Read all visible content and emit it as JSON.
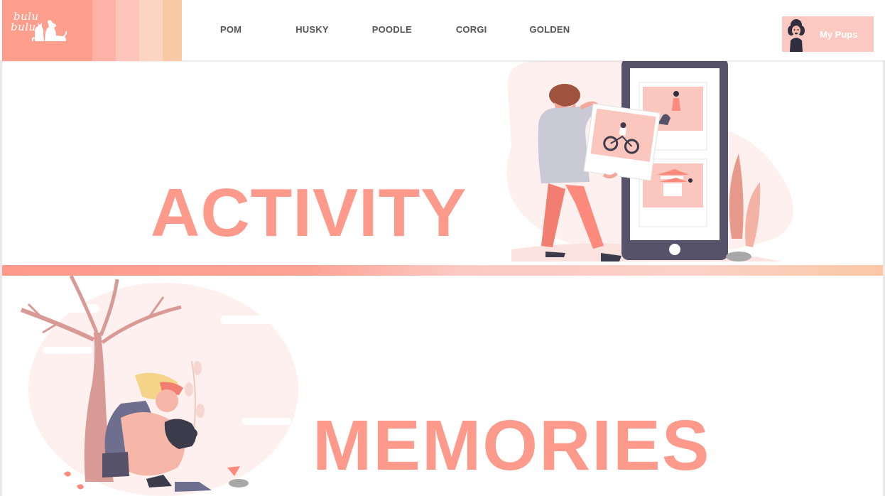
{
  "brand": {
    "logo_line1": "bulu",
    "logo_line2": "bulu",
    "palette": [
      "#fe9f8e",
      "#fdb1a7",
      "#fdc4bc",
      "#fbd4c2",
      "#f9c8a5"
    ]
  },
  "nav": {
    "items": [
      {
        "label": "POM"
      },
      {
        "label": "HUSKY"
      },
      {
        "label": "POODLE"
      },
      {
        "label": "CORGI"
      },
      {
        "label": "GOLDEN"
      }
    ]
  },
  "account": {
    "label": "My Pups",
    "avatar_icon": "poodle-avatar-icon"
  },
  "sections": {
    "activity": {
      "title": "ACTIVITY",
      "illustration": "man-holding-photo-by-phone"
    },
    "memories": {
      "title": "MEMORIES",
      "illustration": "woman-hugging-dog-under-tree"
    }
  },
  "colors": {
    "accent": "#fd9a8b",
    "nav_text": "#555555",
    "button_bg": "#fbc9c2"
  }
}
